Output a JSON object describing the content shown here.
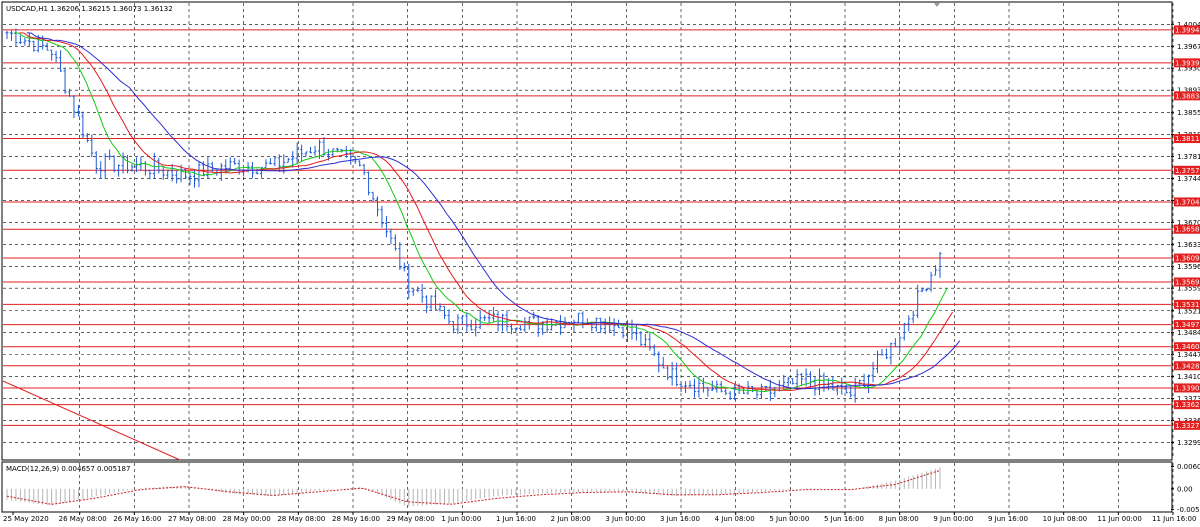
{
  "window": {
    "symbol_header": "USDCAD,H1  1.36206 1.36215 1.36073 1.36132",
    "macd_header": "MACD(12,26,9) 0.004657 0.005187"
  },
  "colors": {
    "candle": "#1e5bd6",
    "ma_fast": "#14c814",
    "ma_mid": "#e21b1b",
    "ma_slow": "#2d2dd2",
    "hline": "#e22020",
    "grid": "#000000",
    "macd_hist": "#b4b4b4",
    "macd_signal": "#cc2020"
  },
  "chart_data": {
    "type": "line",
    "title": "USDCAD,H1",
    "price_axis": {
      "ylim": [
        1.3271,
        1.404
      ],
      "tick_labels": [
        1.4004,
        1.3967,
        1.393,
        1.3893,
        1.3855,
        1.3818,
        1.3781,
        1.3744,
        1.3707,
        1.367,
        1.3633,
        1.3596,
        1.3559,
        1.3521,
        1.3484,
        1.3447,
        1.341,
        1.3373,
        1.3336,
        1.3299
      ]
    },
    "x_axis_labels": [
      "25 May 2020",
      "26 May 08:00",
      "26 May 16:00",
      "27 May 08:00",
      "28 May 00:00",
      "28 May 08:00",
      "28 May 16:00",
      "29 May 08:00",
      "1 Jun 00:00",
      "1 Jun 16:00",
      "2 Jun 08:00",
      "3 Jun 00:00",
      "3 Jun 16:00",
      "4 Jun 08:00",
      "5 Jun 00:00",
      "5 Jun 16:00",
      "8 Jun 08:00",
      "9 Jun 00:00",
      "9 Jun 16:00",
      "10 Jun 08:00",
      "11 Jun 00:00",
      "11 Jun 16:00"
    ],
    "horizontal_levels": [
      "1.39946",
      "1.39391",
      "1.38834",
      "1.38114",
      "1.37579",
      "1.37045",
      "1.36585",
      "1.36099",
      "1.35695",
      "1.35318",
      "1.34977",
      "1.34604",
      "1.34282",
      "1.33908",
      "1.33626",
      "1.33278"
    ],
    "series": [
      {
        "name": "USDCAD",
        "x": [
          "25 May 2020",
          "26 May 08:00",
          "26 May 16:00",
          "27 May 08:00",
          "28 May 00:00",
          "28 May 08:00",
          "28 May 16:00",
          "29 May 08:00",
          "1 Jun 00:00",
          "1 Jun 16:00",
          "2 Jun 08:00",
          "3 Jun 00:00",
          "3 Jun 16:00",
          "4 Jun 08:00",
          "5 Jun 00:00",
          "5 Jun 16:00",
          "8 Jun 08:00",
          "9 Jun 00:00",
          "9 Jun 16:00",
          "10 Jun 08:00",
          "11 Jun 00:00",
          "11 Jun 16:00"
        ],
        "values": [
          1.399,
          1.396,
          1.377,
          1.3765,
          1.375,
          1.3765,
          1.3765,
          1.38,
          1.376,
          1.357,
          1.35,
          1.3505,
          1.35,
          1.351,
          1.349,
          1.341,
          1.3385,
          1.338,
          1.3405,
          1.338,
          1.347,
          1.3613
        ]
      }
    ],
    "macd": {
      "label": "MACD(12,26,9)",
      "ylim": [
        -0.006,
        0.007
      ],
      "tick_labels": [
        0.00606,
        0.0,
        -0.00556
      ],
      "histogram": [
        -0.003,
        -0.0045,
        -0.002,
        0.0002,
        0.0008,
        -0.0012,
        -0.002,
        -0.0005,
        0.0005,
        -0.0048,
        -0.004,
        -0.002,
        -0.0012,
        -0.0008,
        -0.0008,
        -0.002,
        -0.0015,
        -0.0008,
        0.0002,
        -0.0002,
        0.0022,
        0.0058
      ],
      "signal": [
        -0.002,
        -0.0042,
        -0.0025,
        -0.0002,
        0.0006,
        -0.0008,
        -0.0018,
        -0.0008,
        0.0002,
        -0.0035,
        -0.0042,
        -0.0026,
        -0.0016,
        -0.001,
        -0.0008,
        -0.0016,
        -0.0016,
        -0.001,
        -0.0002,
        -0.0002,
        0.0012,
        0.005
      ]
    }
  }
}
